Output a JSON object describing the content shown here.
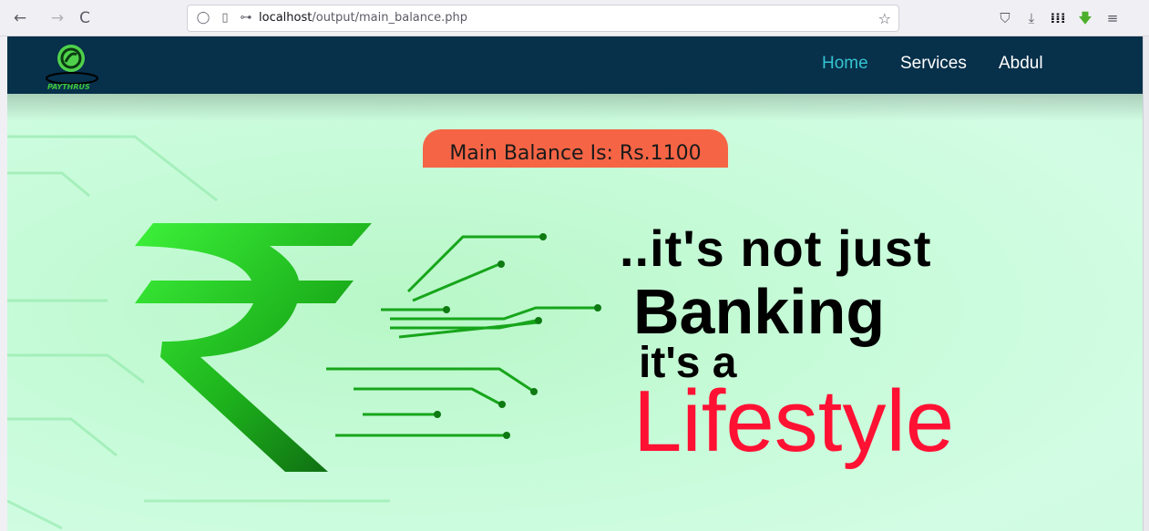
{
  "browser": {
    "url_host": "localhost",
    "url_path": "/output/main_balance.php"
  },
  "navbar": {
    "logo_text": "PAYTHRUS",
    "links": [
      {
        "label": "Home",
        "active": true
      },
      {
        "label": "Services",
        "active": false
      },
      {
        "label": "Abdul",
        "active": false
      }
    ]
  },
  "balance": {
    "text": "Main Balance Is: Rs.1100"
  },
  "hero": {
    "line1": "..it's not just",
    "line2": "Banking",
    "line3": "it's a",
    "line4": "Lifestyle"
  },
  "colors": {
    "navbar_bg": "#07304a",
    "active_link": "#35c3d1",
    "balance_bg": "#f56545",
    "lifestyle": "#ff1133"
  }
}
